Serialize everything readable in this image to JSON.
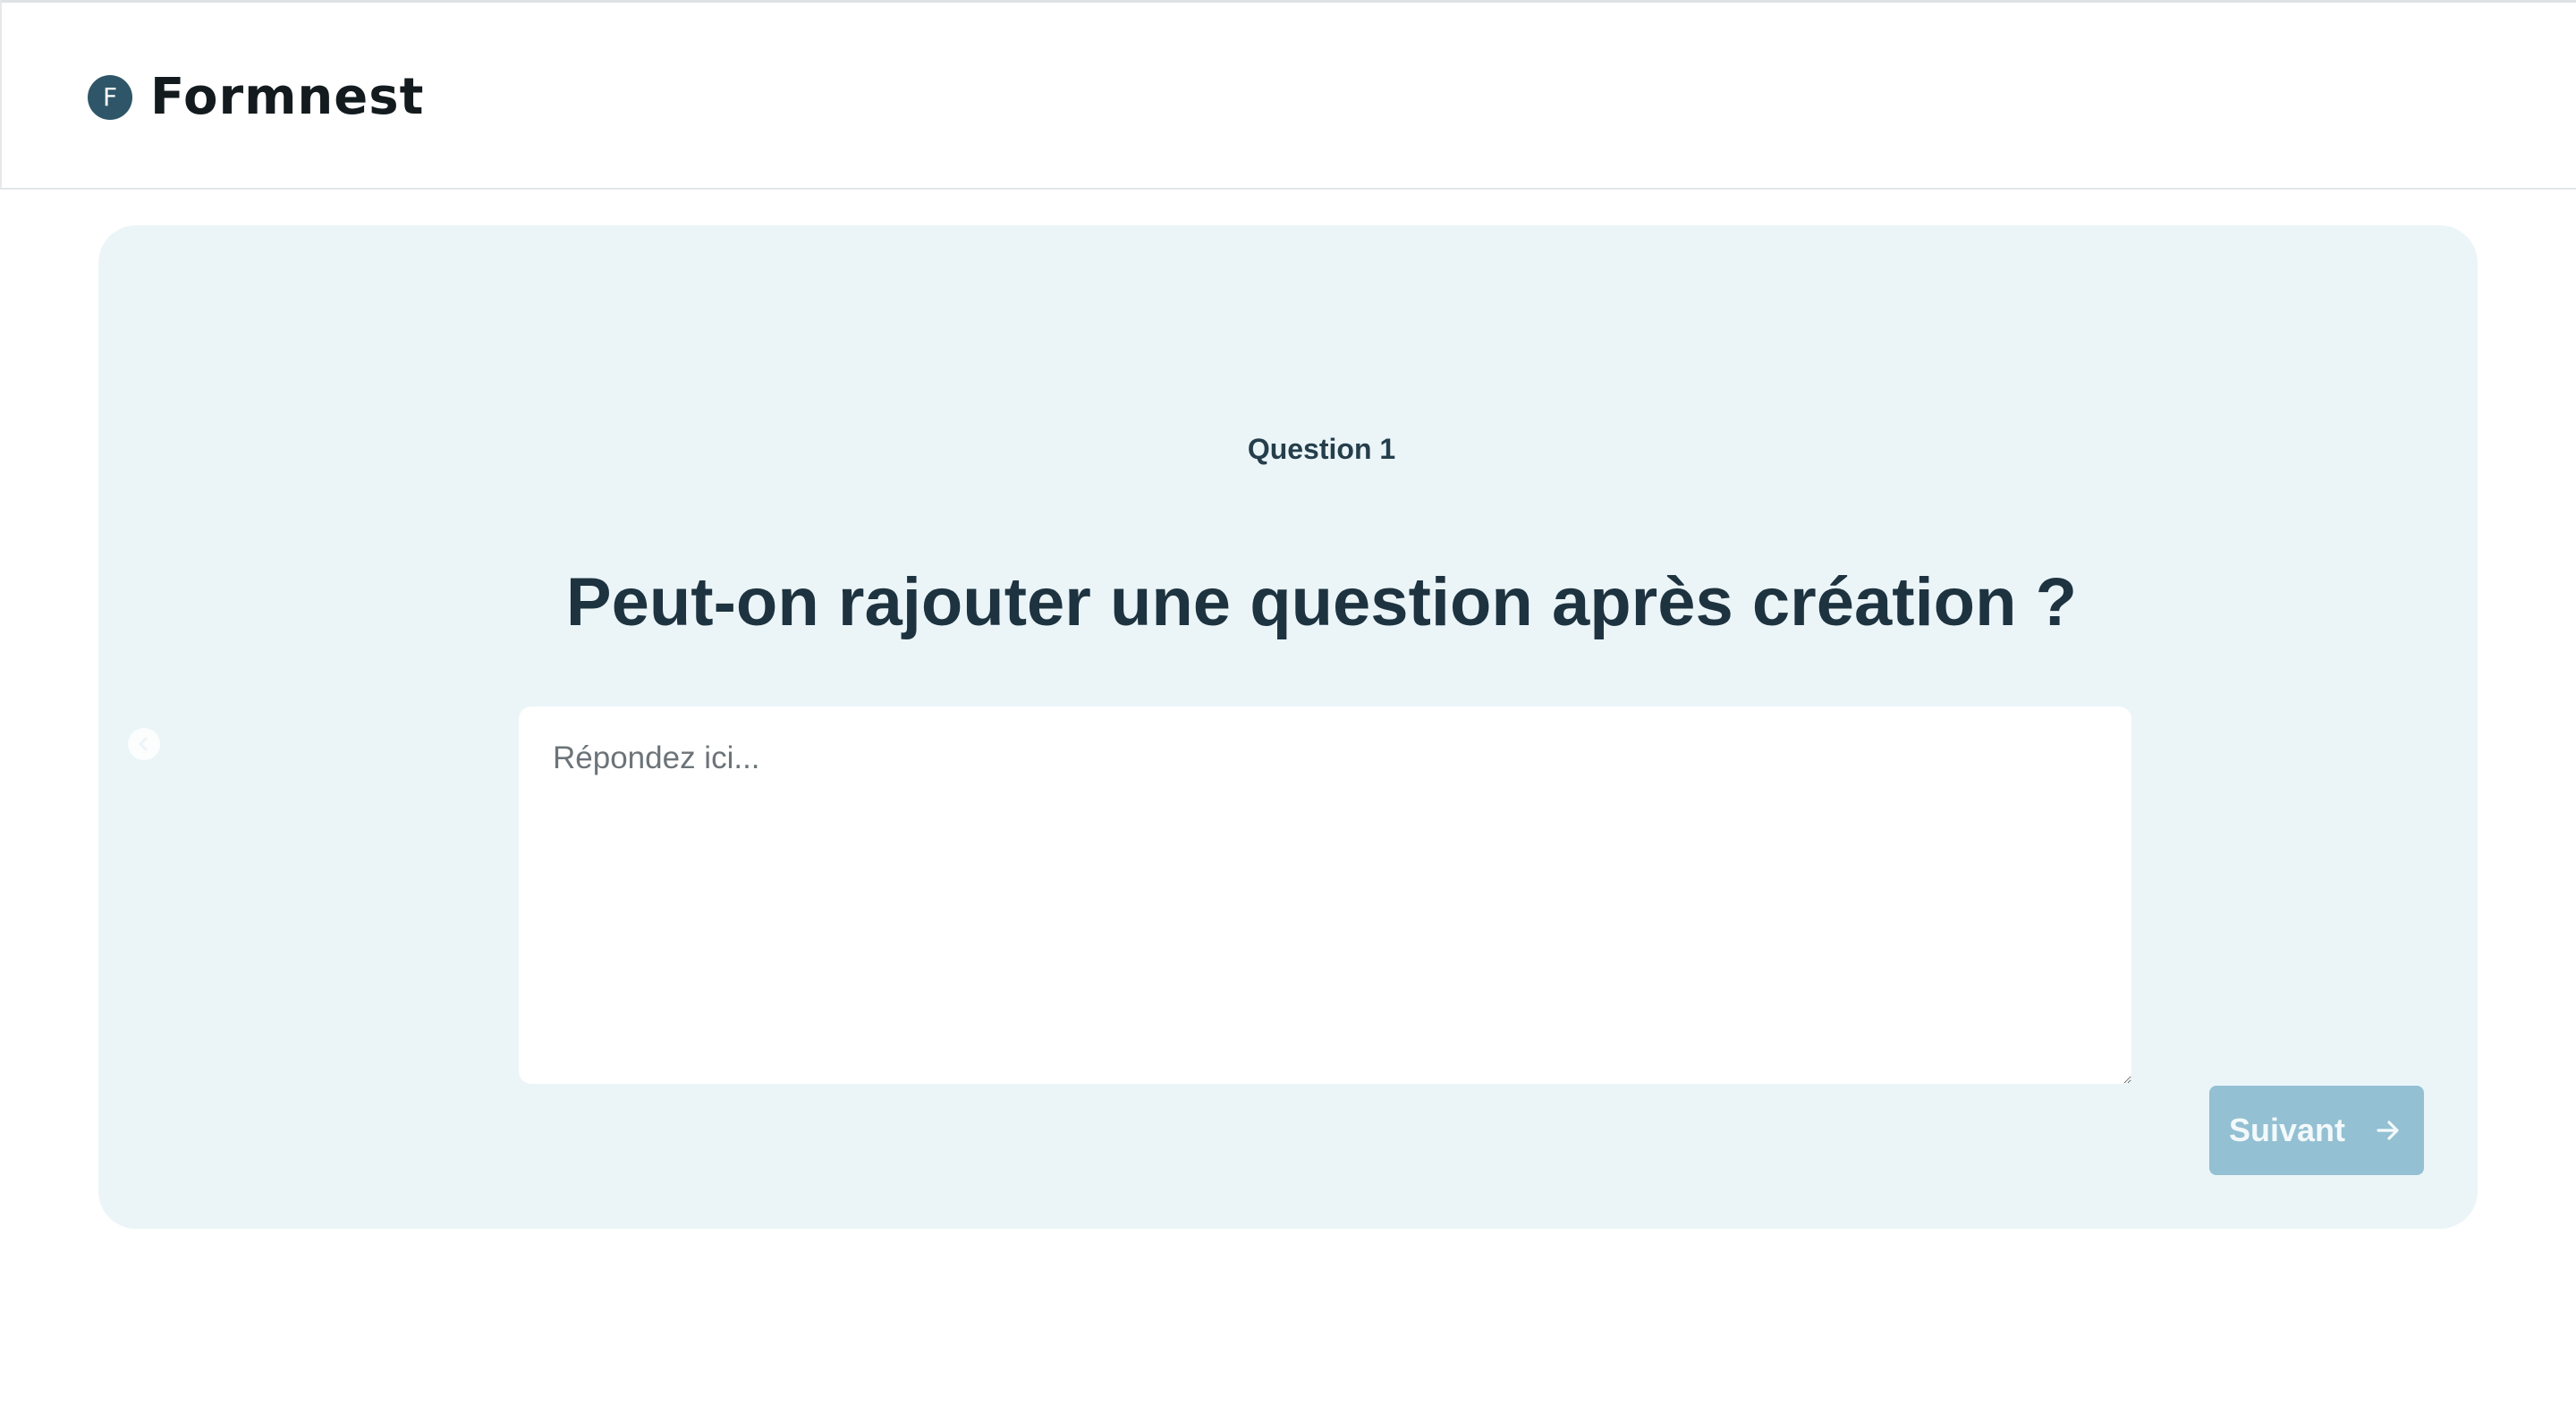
{
  "header": {
    "logo_letter": "F",
    "brand_name": "Formnest"
  },
  "question": {
    "number_label": "Question 1",
    "title": "Peut-on rajouter une question après création ?"
  },
  "answer": {
    "placeholder": "Répondez ici...",
    "value": ""
  },
  "navigation": {
    "next_label": "Suivant",
    "next_icon": "arrow-right-icon",
    "prev_icon": "chevron-left-circle-icon"
  },
  "colors": {
    "card_background": "#ebf5f8",
    "brand": "#2f5668",
    "next_button": "#93c0d2",
    "title_text": "#1e3340"
  }
}
